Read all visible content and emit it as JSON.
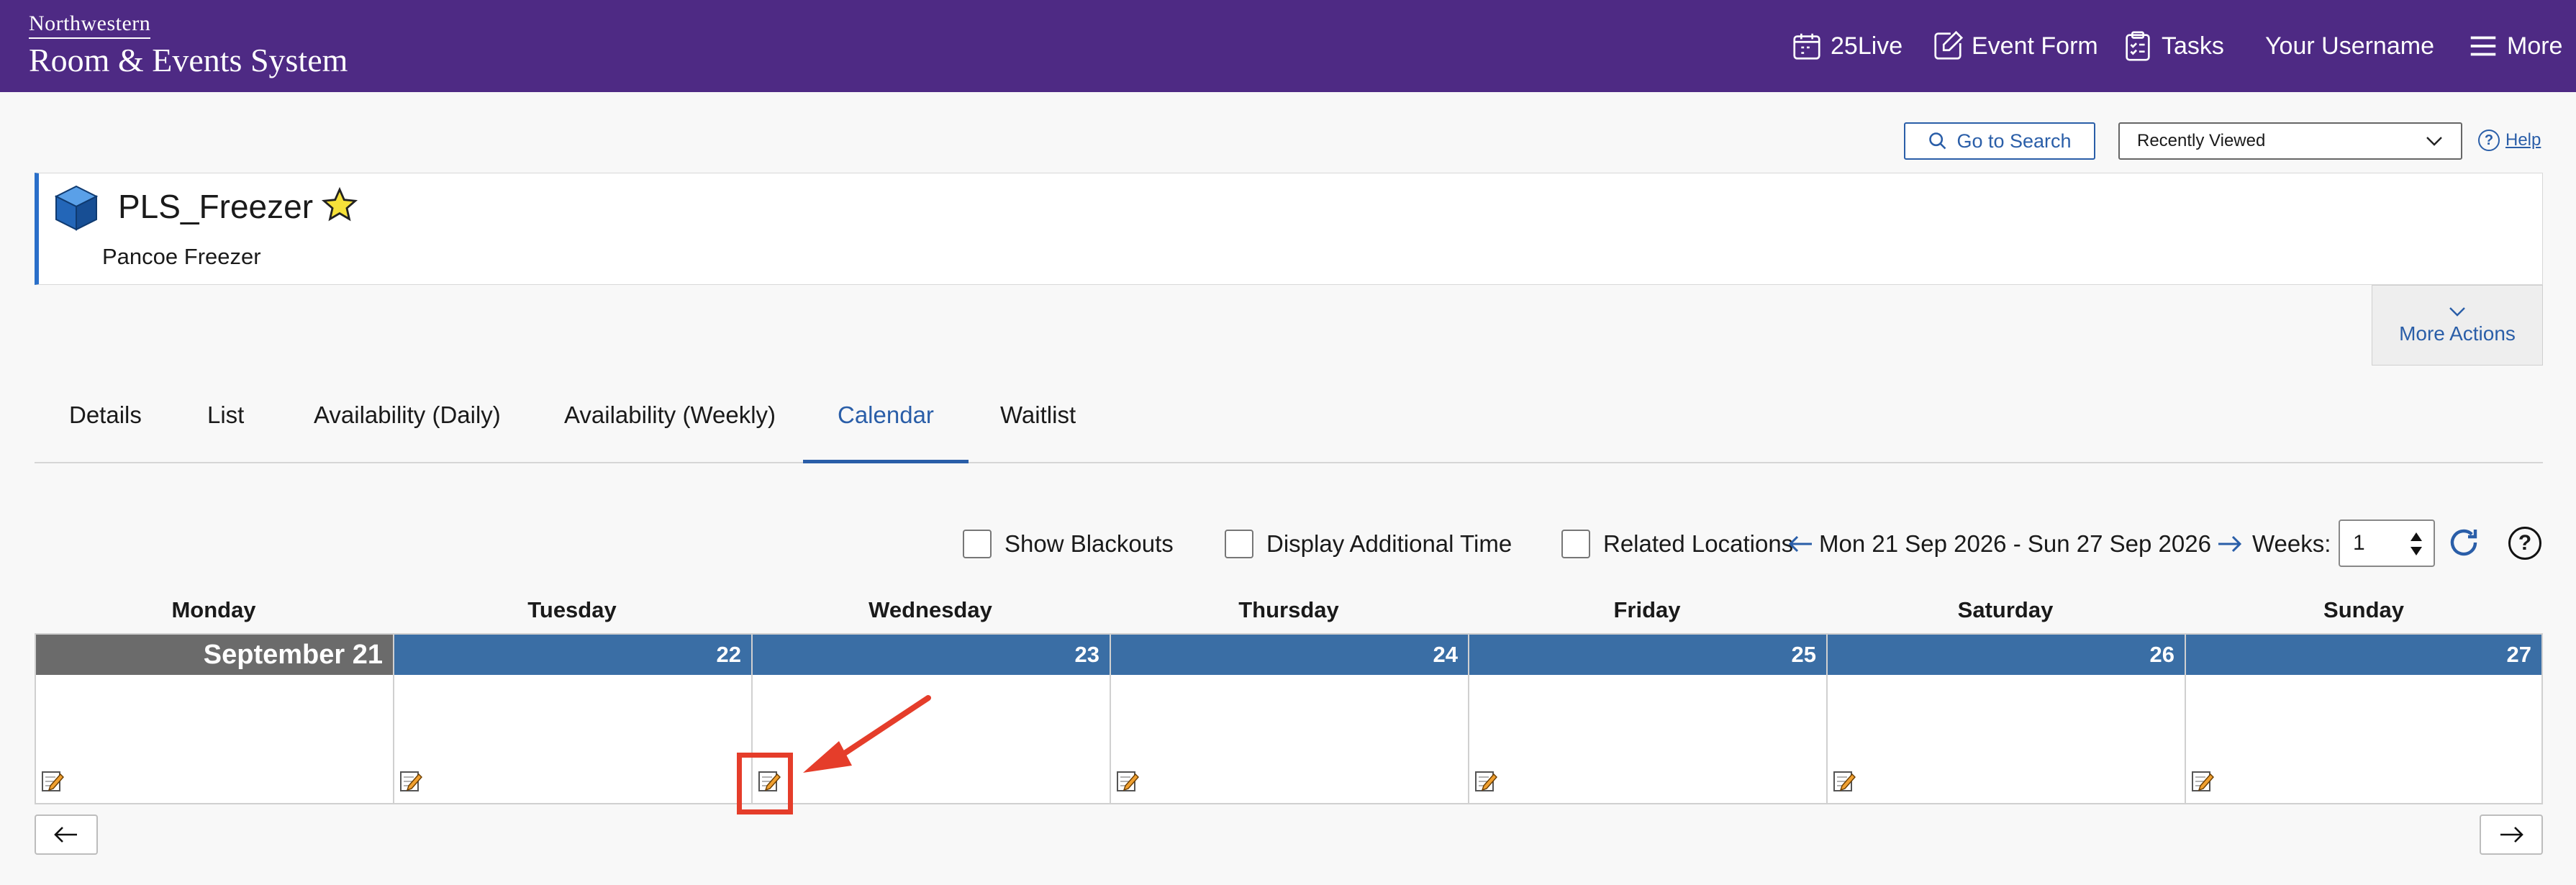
{
  "header": {
    "brand_small": "Northwestern",
    "brand_big": "Room & Events System",
    "nav": [
      {
        "label": "25Live",
        "icon": "calendar-icon"
      },
      {
        "label": "Event Form",
        "icon": "edit-form-icon"
      },
      {
        "label": "Tasks",
        "icon": "clipboard-checklist-icon"
      },
      {
        "label": "Your Username",
        "icon": ""
      },
      {
        "label": "More",
        "icon": "hamburger-menu-icon"
      }
    ]
  },
  "toolbar": {
    "search_label": "Go to Search",
    "recent_label": "Recently Viewed",
    "help_label": "Help"
  },
  "location": {
    "name": "PLS_Freezer",
    "subtitle": "Pancoe Freezer",
    "more_actions": "More Actions"
  },
  "tabs": [
    {
      "label": "Details"
    },
    {
      "label": "List"
    },
    {
      "label": "Availability (Daily)"
    },
    {
      "label": "Availability (Weekly)"
    },
    {
      "label": "Calendar",
      "active": true
    },
    {
      "label": "Waitlist"
    }
  ],
  "calendar": {
    "options": {
      "show_blackouts": "Show Blackouts",
      "display_additional_time": "Display Additional Time",
      "related_locations": "Related Locations"
    },
    "date_range": "Mon 21 Sep 2026 - Sun 27 Sep 2026",
    "weeks_label": "Weeks:",
    "weeks_value": "1",
    "days": [
      {
        "name": "Monday",
        "date": "September 21",
        "today": true
      },
      {
        "name": "Tuesday",
        "date": "22"
      },
      {
        "name": "Wednesday",
        "date": "23"
      },
      {
        "name": "Thursday",
        "date": "24"
      },
      {
        "name": "Friday",
        "date": "25"
      },
      {
        "name": "Saturday",
        "date": "26"
      },
      {
        "name": "Sunday",
        "date": "27"
      }
    ]
  },
  "colors": {
    "header_bg": "#4e2a84",
    "accent": "#2a5ea8",
    "day_bar": "#3a6ea5",
    "today_bar": "#6b6b6b",
    "annotation": "#e53d2a"
  }
}
